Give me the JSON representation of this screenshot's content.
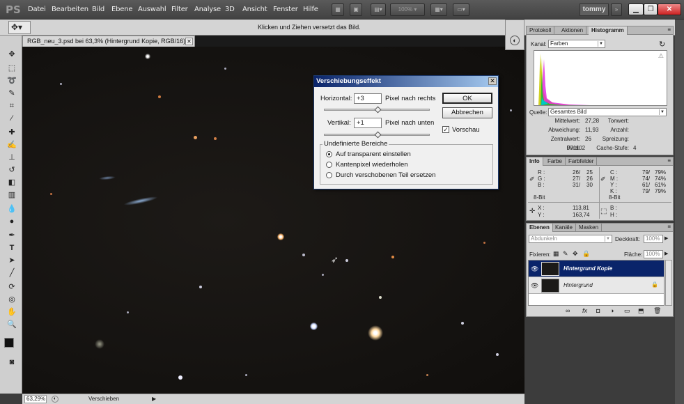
{
  "app": {
    "logo": "PS",
    "user": "tommy"
  },
  "menu": [
    "Datei",
    "Bearbeiten",
    "Bild",
    "Ebene",
    "Auswahl",
    "Filter",
    "Analyse",
    "3D",
    "Ansicht",
    "Fenster",
    "Hilfe"
  ],
  "menu_zoom": "100%",
  "options": {
    "hint": "Klicken und Ziehen versetzt das Bild."
  },
  "document": {
    "tab": "RGB_neu_3.psd bei 63,3% (Hintergrund Kopie, RGB/16) *"
  },
  "status": {
    "zoom": "63,29%",
    "mode": "Verschieben"
  },
  "dialog": {
    "title": "Verschiebungseffekt",
    "horizontal_label": "Horizontal:",
    "horizontal_value": "+3",
    "horizontal_unit": "Pixel nach rechts",
    "vertical_label": "Vertikal:",
    "vertical_value": "+1",
    "vertical_unit": "Pixel nach unten",
    "ok": "OK",
    "cancel": "Abbrechen",
    "preview": "Vorschau",
    "preview_checked": true,
    "group_title": "Undefinierte Bereiche",
    "options": [
      "Auf transparent einstellen",
      "Kantenpixel wiederholen",
      "Durch verschobenen Teil ersetzen"
    ],
    "selected_option": 0
  },
  "histogram": {
    "tabs": [
      "Protokoll",
      "Aktionen",
      "Histogramm"
    ],
    "channel_label": "Kanal:",
    "channel": "Farben",
    "source_label": "Quelle:",
    "source": "Gesamtes Bild",
    "stats_left": [
      [
        "Mittelwert:",
        "27,28"
      ],
      [
        "Abweichung:",
        "11,93"
      ],
      [
        "Zentralwert:",
        "26"
      ],
      [
        "Pixel:",
        "971102"
      ]
    ],
    "stats_right": [
      [
        "Tonwert:",
        ""
      ],
      [
        "Anzahl:",
        ""
      ],
      [
        "Spreizung:",
        ""
      ],
      [
        "Cache-Stufe:",
        "4"
      ]
    ]
  },
  "info": {
    "tabs": [
      "Info",
      "Farbe",
      "Farbfelder"
    ],
    "rgb": [
      [
        "R :",
        "26/",
        "25"
      ],
      [
        "G :",
        "27/",
        "26"
      ],
      [
        "B :",
        "31/",
        "30"
      ]
    ],
    "cmyk": [
      [
        "C :",
        "79/",
        "79%"
      ],
      [
        "M :",
        "74/",
        "74%"
      ],
      [
        "Y :",
        "61/",
        "61%"
      ],
      [
        "K :",
        "79/",
        "79%"
      ]
    ],
    "bit_left": "8-Bit",
    "bit_right": "8-Bit",
    "xy": [
      [
        "X :",
        "113,81"
      ],
      [
        "Y :",
        "163,74"
      ]
    ],
    "wh": [
      [
        "B :",
        ""
      ],
      [
        "H :",
        ""
      ]
    ]
  },
  "layers": {
    "tabs": [
      "Ebenen",
      "Kanäle",
      "Masken"
    ],
    "blend": "Abdunkeln",
    "opacity_label": "Deckkraft:",
    "opacity": "100%",
    "lock_label": "Fixieren:",
    "fill_label": "Fläche:",
    "fill": "100%",
    "items": [
      {
        "name": "Hintergrund Kopie",
        "selected": true
      },
      {
        "name": "Hintergrund",
        "selected": false
      }
    ]
  }
}
